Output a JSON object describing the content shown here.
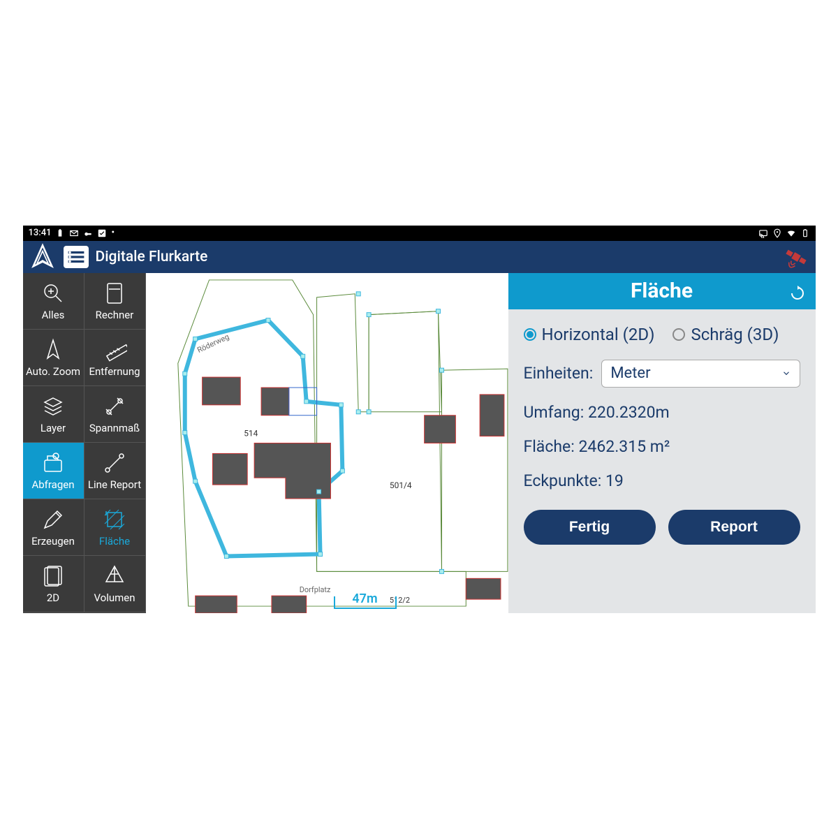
{
  "statusbar": {
    "time": "13:41"
  },
  "header": {
    "title": "Digitale Flurkarte"
  },
  "toolbar": {
    "items": [
      {
        "label": "Alles"
      },
      {
        "label": "Rechner"
      },
      {
        "label": "Auto. Zoom"
      },
      {
        "label": "Entfernung"
      },
      {
        "label": "Layer"
      },
      {
        "label": "Spannmaß"
      },
      {
        "label": "Abfragen"
      },
      {
        "label": "Line Report"
      },
      {
        "label": "Erzeugen"
      },
      {
        "label": "Fläche"
      },
      {
        "label": "2D"
      },
      {
        "label": "Volumen"
      }
    ]
  },
  "map": {
    "street1": "Röderweg",
    "street2": "Dorfplatz",
    "parcel1": "514",
    "parcel2": "501/4",
    "parcel3": "512/2",
    "scale": "47m"
  },
  "panel": {
    "title": "Fläche",
    "radio_2d": "Horizontal (2D)",
    "radio_3d": "Schräg (3D)",
    "units_label": "Einheiten:",
    "units_value": "Meter",
    "perimeter": "Umfang: 220.2320m",
    "area": "Fläche: 2462.315 m²",
    "vertices": "Eckpunkte: 19",
    "btn_done": "Fertig",
    "btn_report": "Report"
  }
}
